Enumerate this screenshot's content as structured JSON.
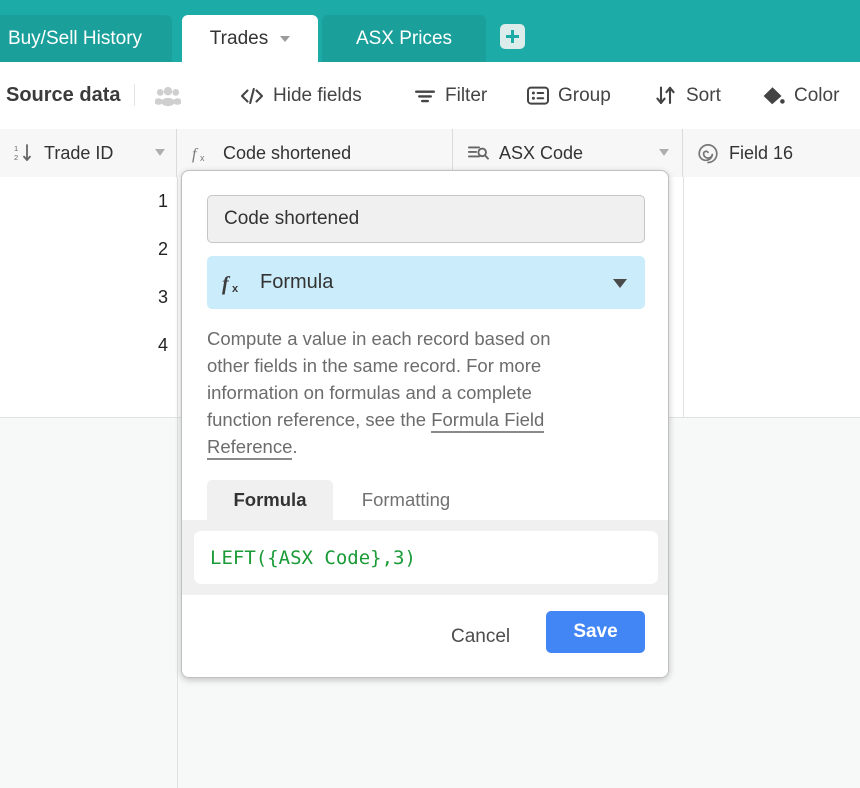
{
  "tabs": {
    "items": [
      {
        "label": "Buy/Sell History",
        "active": false
      },
      {
        "label": "Trades",
        "active": true
      },
      {
        "label": "ASX Prices",
        "active": false
      }
    ],
    "add_tab_icon": "plus-icon",
    "teal": "#1CABA6"
  },
  "toolbar": {
    "source_data_label": "Source data",
    "collaborators_icon": "people-icon",
    "items": [
      {
        "label": "Hide fields",
        "icon": "code-brackets-icon"
      },
      {
        "label": "Filter",
        "icon": "filter-icon"
      },
      {
        "label": "Group",
        "icon": "group-list-icon"
      },
      {
        "label": "Sort",
        "icon": "sort-arrows-icon"
      },
      {
        "label": "Color",
        "icon": "paint-bucket-icon"
      }
    ]
  },
  "grid": {
    "columns": [
      {
        "name": "Trade ID",
        "icon": "number-sort-icon",
        "has_caret": true
      },
      {
        "name": "Code shortened",
        "icon": "formula-fx-icon",
        "has_caret": false
      },
      {
        "name": "ASX Code",
        "icon": "lookup-search-icon",
        "has_caret": true
      },
      {
        "name": "Field 16",
        "icon": "spiral-icon",
        "has_caret": false
      }
    ],
    "row_numbers": [
      "1",
      "2",
      "3",
      "4"
    ]
  },
  "popup": {
    "field_name_value": "Code shortened",
    "field_name_placeholder": "Field name",
    "field_type": {
      "label": "Formula",
      "icon": "formula-fx-icon",
      "caret_icon": "chevron-down-icon"
    },
    "description": {
      "text_before": "Compute a value in each record based on other fields in the same record. For more information on formulas and a complete function reference, see the ",
      "link_text": "Formula Field Reference",
      "text_after": "."
    },
    "subtabs": [
      {
        "label": "Formula",
        "active": true
      },
      {
        "label": "Formatting",
        "active": false
      }
    ],
    "formula_value": "LEFT({ASX Code},3)",
    "formula_color": "#1a9b37",
    "cancel_label": "Cancel",
    "save_label": "Save",
    "save_color": "#4285f4"
  }
}
